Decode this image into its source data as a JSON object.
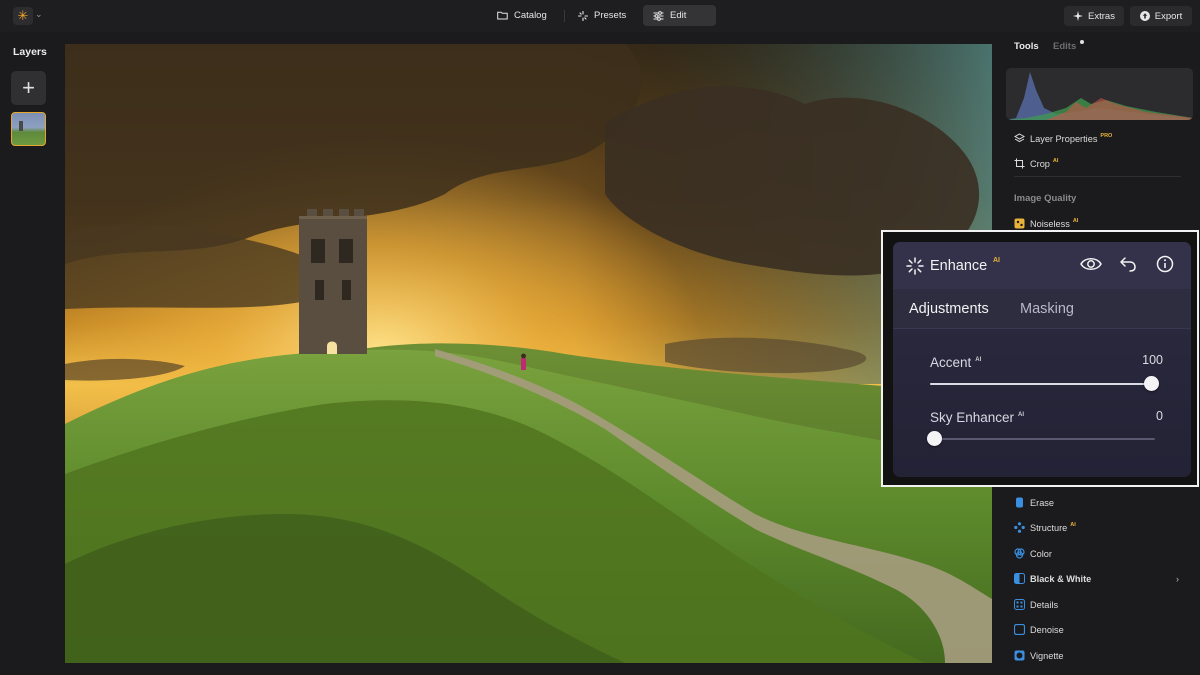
{
  "topbar": {
    "nav": [
      {
        "label": "Catalog",
        "icon": "folder-icon"
      },
      {
        "label": "Presets",
        "icon": "sparkle-icon"
      },
      {
        "label": "Edit",
        "icon": "sliders-icon",
        "active": true
      }
    ],
    "extras_label": "Extras",
    "export_label": "Export"
  },
  "left_panel": {
    "title": "Layers"
  },
  "right_panel": {
    "tabs": {
      "tools": "Tools",
      "edits": "Edits"
    },
    "items_top": [
      {
        "label": "Layer Properties",
        "tag": "PRO",
        "icon": "layers-icon"
      },
      {
        "label": "Crop",
        "tag": "AI",
        "icon": "crop-icon"
      }
    ],
    "section_title": "Image Quality",
    "noiseless": {
      "label": "Noiseless",
      "tag": "AI",
      "icon": "noiseless-icon"
    },
    "items_bottom": [
      {
        "label": "Erase",
        "tag": "",
        "icon": "erase-icon"
      },
      {
        "label": "Structure",
        "tag": "AI",
        "icon": "structure-icon"
      },
      {
        "label": "Color",
        "tag": "",
        "icon": "color-icon"
      },
      {
        "label": "Black & White",
        "tag": "",
        "icon": "black-white-icon",
        "bold": true
      },
      {
        "label": "Details",
        "tag": "",
        "icon": "details-icon"
      },
      {
        "label": "Denoise",
        "tag": "",
        "icon": "denoise-icon"
      },
      {
        "label": "Vignette",
        "tag": "",
        "icon": "vignette-icon"
      }
    ]
  },
  "enhance": {
    "title": "Enhance",
    "ai_tag": "AI",
    "tabs": {
      "adjustments": "Adjustments",
      "masking": "Masking"
    },
    "sliders": [
      {
        "label": "Accent",
        "ai": "AI",
        "value": "100",
        "level": 1.0
      },
      {
        "label": "Sky Enhancer",
        "ai": "AI",
        "value": "0",
        "level": 0.0
      }
    ]
  },
  "colors": {
    "accent": "#e8b33a",
    "enhance_bg": "#2e2c3f"
  }
}
